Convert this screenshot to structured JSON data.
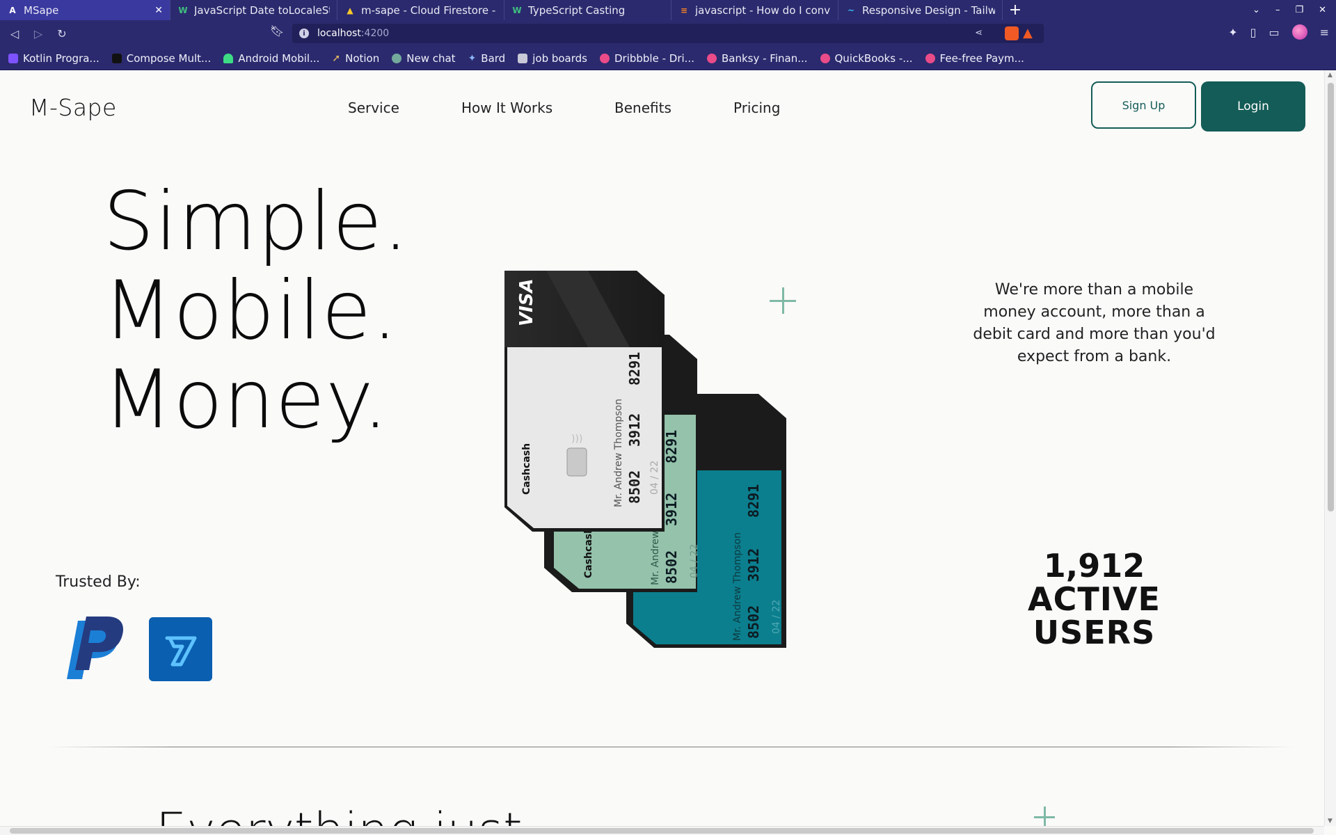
{
  "browser": {
    "tabs": [
      {
        "title": "MSape",
        "active": true,
        "icon": "angular-icon"
      },
      {
        "title": "JavaScript Date toLocaleString",
        "icon": "w3schools-icon"
      },
      {
        "title": "m-sape - Cloud Firestore - Fire",
        "icon": "firebase-icon"
      },
      {
        "title": "TypeScript Casting",
        "icon": "w3schools-icon"
      },
      {
        "title": "javascript - How do I convert a",
        "icon": "stackoverflow-icon"
      },
      {
        "title": "Responsive Design - Tailwind",
        "icon": "tailwind-icon"
      }
    ],
    "url": {
      "host": "localhost",
      "port": ":4200"
    },
    "bookmarks": [
      {
        "label": "Kotlin Progra...",
        "color": "#7f52ff"
      },
      {
        "label": "Compose Mult...",
        "color": "#111111"
      },
      {
        "label": "Android Mobil...",
        "color": "#3ddc84"
      },
      {
        "label": "Notion",
        "color": "#e9e9e9"
      },
      {
        "label": "New chat",
        "color": "#74aa9c"
      },
      {
        "label": "Bard",
        "color": "#8ab4f8"
      },
      {
        "label": "job boards",
        "color": "#c9c9d8"
      },
      {
        "label": "Dribbble - Dri...",
        "color": "#ea4c89"
      },
      {
        "label": "Banksy - Finan...",
        "color": "#ea4c89"
      },
      {
        "label": "QuickBooks -...",
        "color": "#ea4c89"
      },
      {
        "label": "Fee-free Paym...",
        "color": "#ea4c89"
      }
    ]
  },
  "site": {
    "logo": "M-Sape",
    "nav": [
      "Service",
      "How It Works",
      "Benefits",
      "Pricing"
    ],
    "signup_label": "Sign Up",
    "login_label": "Login",
    "brand_color": "#145c57",
    "hero_lines": [
      "Simple.",
      "Mobile.",
      "Money."
    ],
    "tagline": "We're more than a mobile money account, more than a debit card and more than you'd expect from a bank.",
    "stat_number": "1,912",
    "stat_label_1": "ACTIVE",
    "stat_label_2": "USERS",
    "trusted_label": "Trusted By:",
    "partners": [
      "paypal-logo",
      "wise-logo"
    ],
    "section2_heading": "Everything just",
    "cards": {
      "brand": "VISA",
      "issuer": "Cashcash",
      "holder": "Mr. Andrew Thompson",
      "number": [
        "8502",
        "3912",
        "8291"
      ],
      "expiry": "04 / 22",
      "colors": [
        "#e8e8e8",
        "#94c2ab",
        "#0b7f8e"
      ]
    }
  }
}
